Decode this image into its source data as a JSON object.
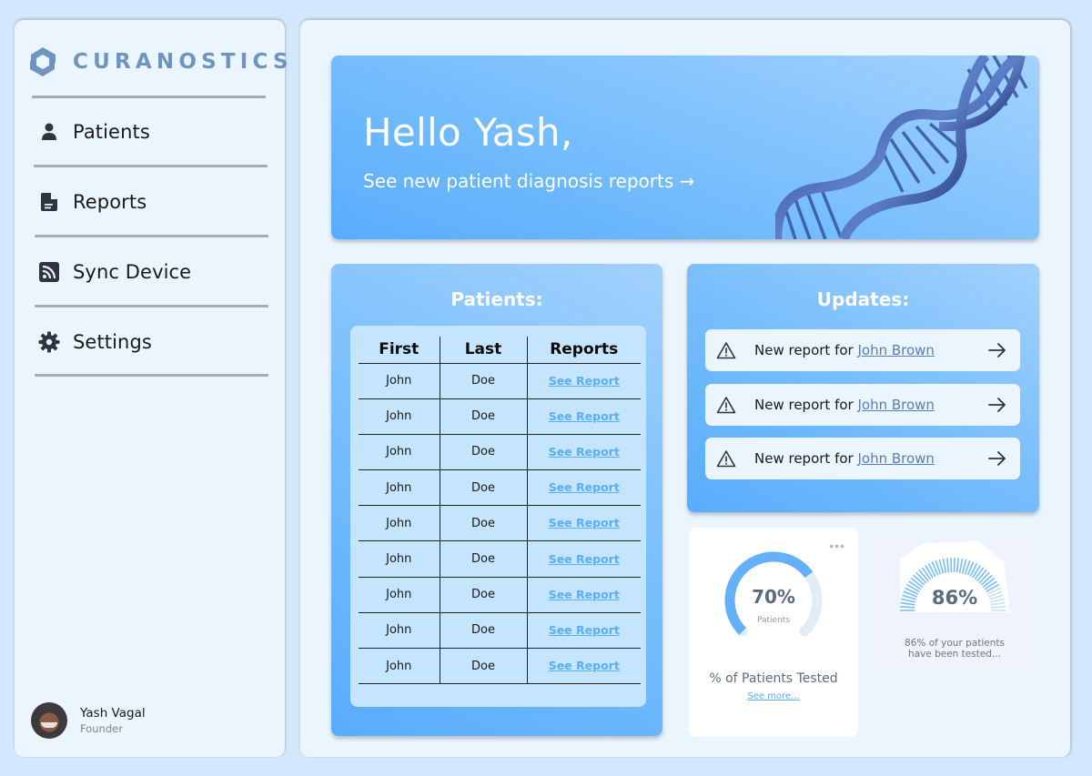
{
  "brand": {
    "name": "CURANOSTICS",
    "logo_icon": "hexagon-s-logo-icon",
    "color": "#6f94c2"
  },
  "sidebar": {
    "items": [
      {
        "label": "Patients",
        "icon": "user-icon"
      },
      {
        "label": "Reports",
        "icon": "document-icon"
      },
      {
        "label": "Sync Device",
        "icon": "rss-icon"
      },
      {
        "label": "Settings",
        "icon": "gear-icon"
      }
    ],
    "profile": {
      "name": "Yash Vagal",
      "role": "Founder"
    }
  },
  "hero": {
    "greeting": "Hello Yash,",
    "link": "See new patient diagnosis reports →",
    "image": "dna-helix"
  },
  "patients": {
    "title": "Patients:",
    "columns": [
      "First",
      "Last",
      "Reports"
    ],
    "rows": [
      {
        "first": "John",
        "last": "Doe",
        "report": "See Report"
      },
      {
        "first": "John",
        "last": "Doe",
        "report": "See Report"
      },
      {
        "first": "John",
        "last": "Doe",
        "report": "See Report"
      },
      {
        "first": "John",
        "last": "Doe",
        "report": "See Report"
      },
      {
        "first": "John",
        "last": "Doe",
        "report": "See Report"
      },
      {
        "first": "John",
        "last": "Doe",
        "report": "See Report"
      },
      {
        "first": "John",
        "last": "Doe",
        "report": "See Report"
      },
      {
        "first": "John",
        "last": "Doe",
        "report": "See Report"
      },
      {
        "first": "John",
        "last": "Doe",
        "report": "See Report"
      }
    ]
  },
  "updates": {
    "title": "Updates:",
    "items": [
      {
        "prefix": "New report for ",
        "name": "John Brown"
      },
      {
        "prefix": "New report for ",
        "name": "John Brown"
      },
      {
        "prefix": "New report for ",
        "name": "John Brown"
      }
    ]
  },
  "stat_tested": {
    "value_text": "70%",
    "value": 70,
    "sublabel": "Patients",
    "title": "% of Patients Tested",
    "link": "See more...",
    "menu": "•••"
  },
  "stat_tested_2": {
    "value_text": "86%",
    "value": 86,
    "description_line1": "86% of your patients",
    "description_line2": "have been tested..."
  },
  "colors": {
    "accent": "#5aaef8",
    "card_gradient_start": "#58acfb",
    "card_gradient_end": "#a2d1fd",
    "background": "#d4e8fd",
    "panel": "#eaf5fe",
    "link": "#5a7eb4"
  }
}
